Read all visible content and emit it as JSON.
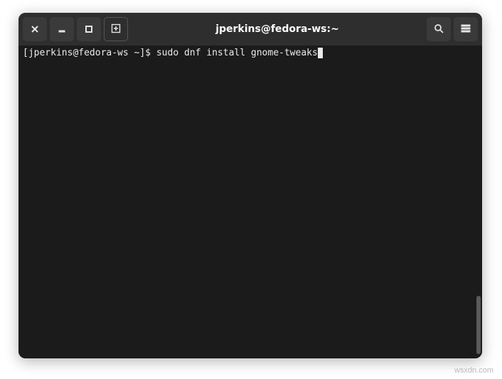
{
  "titlebar": {
    "title": "jperkins@fedora-ws:~"
  },
  "terminal": {
    "prompt": "[jperkins@fedora-ws ~]$ ",
    "command": "sudo dnf install gnome-tweaks"
  },
  "watermark": "wsxdn.com"
}
